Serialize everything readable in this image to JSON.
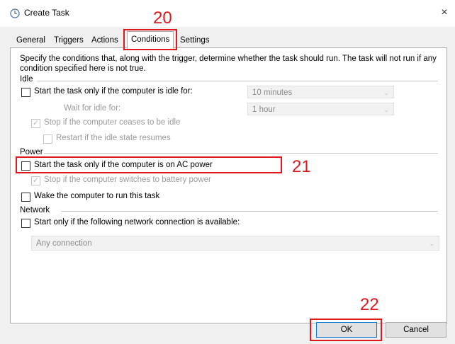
{
  "window": {
    "title": "Create Task",
    "close_symbol": "×"
  },
  "tabs": [
    {
      "label": "General"
    },
    {
      "label": "Triggers"
    },
    {
      "label": "Actions"
    },
    {
      "label": "Conditions",
      "active": true
    },
    {
      "label": "Settings"
    }
  ],
  "description": "Specify the conditions that, along with the trigger, determine whether the task should run.  The task will not run  if any condition specified here is not true.",
  "idle": {
    "section": "Idle",
    "start_if_idle": {
      "label": "Start the task only if the computer is idle for:",
      "checked": false,
      "value": "10 minutes"
    },
    "wait_for_idle": {
      "label": "Wait for idle for:",
      "value": "1 hour"
    },
    "stop_if_not_idle": {
      "label": "Stop if the computer ceases to be idle",
      "checked": true
    },
    "restart_if_idle": {
      "label": "Restart if the idle state resumes",
      "checked": false
    }
  },
  "power": {
    "section": "Power",
    "ac_power": {
      "label": "Start the task only if the computer is on AC power",
      "checked": false
    },
    "battery_stop": {
      "label": "Stop if the computer switches to battery power",
      "checked": true
    },
    "wake": {
      "label": "Wake the computer to run this task",
      "checked": false
    }
  },
  "network": {
    "section": "Network",
    "start_if_network": {
      "label": "Start only if the following network connection is available:",
      "checked": false
    },
    "connection": "Any connection"
  },
  "buttons": {
    "ok": "OK",
    "cancel": "Cancel"
  },
  "annotations": {
    "tab_marker": "20",
    "ac_marker": "21",
    "ok_marker": "22"
  },
  "colors": {
    "annotation_red": "#e0191f",
    "ok_border": "#0078d7"
  }
}
